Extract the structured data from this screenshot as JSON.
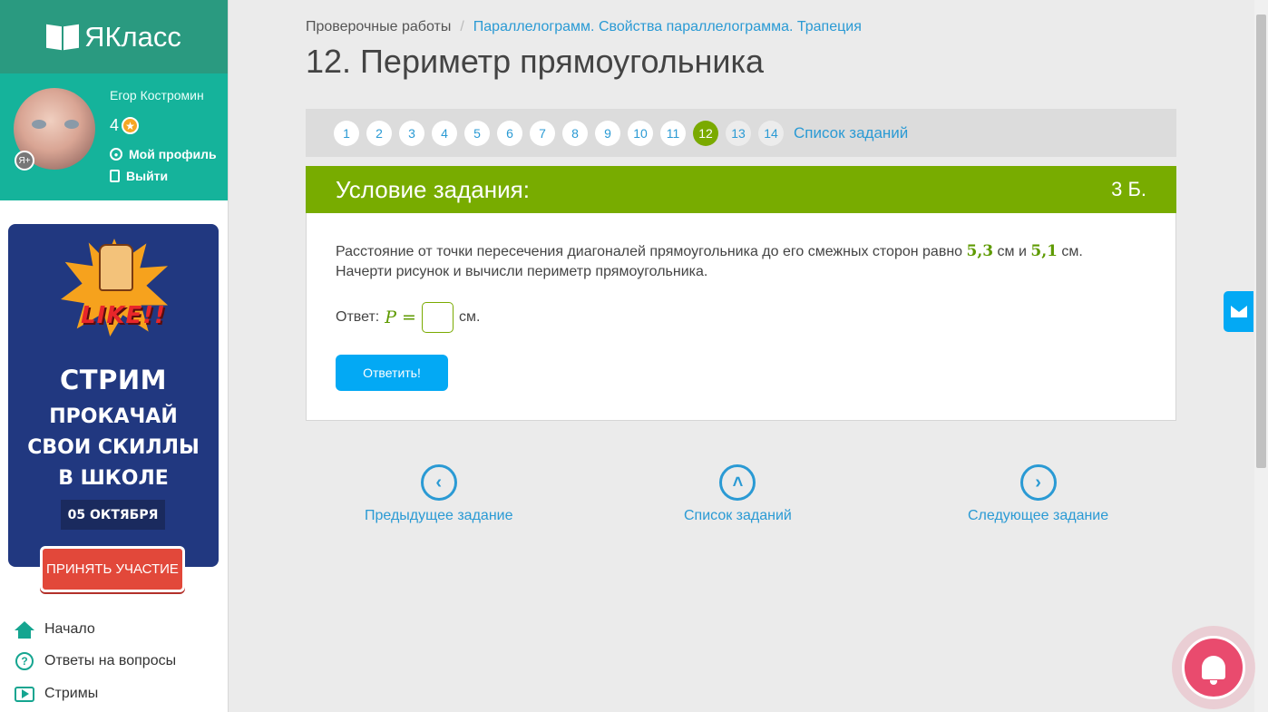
{
  "logo": {
    "text": "ЯКласс"
  },
  "user": {
    "name": "Егор Костромин",
    "score": "4",
    "profile_link": "Мой профиль",
    "logout_link": "Выйти"
  },
  "promo": {
    "badge": "LIKE!!",
    "title_line1": "СТРИМ",
    "title_line2": "ПРОКАЧАЙ",
    "title_line3": "СВОИ СКИЛЛЫ",
    "title_line4": "В ШКОЛЕ",
    "date": "05 ОКТЯБРЯ",
    "button": "ПРИНЯТЬ УЧАСТИЕ"
  },
  "nav": {
    "home": "Начало",
    "answers": "Ответы на вопросы",
    "streams": "Стримы"
  },
  "breadcrumb": {
    "root": "Проверочные работы",
    "separator": "/",
    "current": "Параллелограмм. Свойства параллелограмма. Трапеция"
  },
  "page_title": "12. Периметр прямоугольника",
  "task_nav": {
    "numbers": [
      "1",
      "2",
      "3",
      "4",
      "5",
      "6",
      "7",
      "8",
      "9",
      "10",
      "11",
      "12",
      "13",
      "14"
    ],
    "active": "12",
    "list_link": "Список заданий"
  },
  "condition": {
    "title": "Условие задания:",
    "points": "3 Б.",
    "text_part1": "Расстояние от точки пересечения диагоналей прямоугольника до его смежных сторон равно ",
    "value1": "5,3",
    "text_part2": " см и ",
    "value2": "5,1",
    "text_part3": " см.",
    "text_line2": "Начерти рисунок и вычисли периметр прямоугольника.",
    "answer_label": "Ответ: ",
    "answer_var": "P =",
    "answer_unit": "см.",
    "submit": "Ответить!"
  },
  "bottom_nav": {
    "prev": "Предыдущее задание",
    "list": "Список заданий",
    "next": "Следующее задание"
  },
  "colors": {
    "brand_teal": "#15b39b",
    "green_accent": "#78ac00",
    "link_blue": "#2a9ad4",
    "button_blue": "#03a9f4",
    "bell_pink": "#e94b6e"
  }
}
